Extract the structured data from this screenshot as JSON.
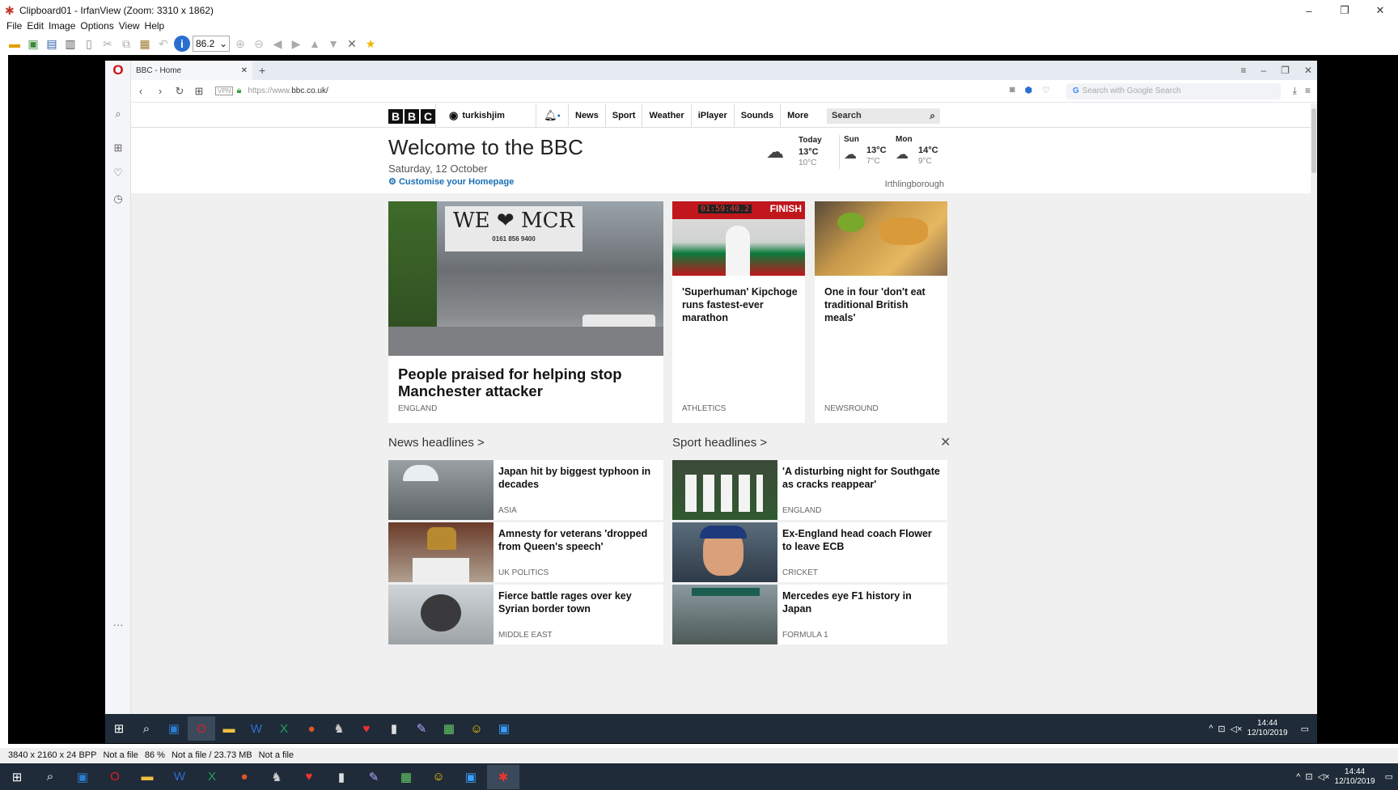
{
  "irfanview": {
    "title": "Clipboard01 - IrfanView (Zoom: 3310 x 1862)",
    "menu": [
      "File",
      "Edit",
      "Image",
      "Options",
      "View",
      "Help"
    ],
    "zoom_value": "86.2",
    "status": [
      "3840 x 2160 x 24 BPP",
      "Not a file",
      "86 %",
      "Not a file / 23.73 MB",
      "Not a file"
    ],
    "window_buttons": [
      "–",
      "❐",
      "✕"
    ]
  },
  "browser": {
    "tab_title": "BBC - Home",
    "url_prefix": "https://www.",
    "url_domain": "bbc.co.uk/",
    "search_placeholder": "Search with Google Search",
    "vpn": "VPN"
  },
  "bbc": {
    "username": "turkishjim",
    "nav": [
      "News",
      "Sport",
      "Weather",
      "iPlayer",
      "Sounds"
    ],
    "more": "More",
    "search": "Search",
    "welcome_title": "Welcome to the BBC",
    "date": "Saturday, 12 October",
    "customise": "Customise your Homepage",
    "weather": {
      "days": [
        {
          "name": "Today",
          "hi": "13°C",
          "lo": "10°C"
        },
        {
          "name": "Sun",
          "hi": "13°C",
          "lo": "7°C"
        },
        {
          "name": "Mon",
          "hi": "14°C",
          "lo": "9°C"
        }
      ],
      "location": "Irthlingborough"
    },
    "top_stories": [
      {
        "headline": "People praised for helping stop Manchester attacker",
        "tag": "ENGLAND",
        "image_text": "WE ❤ MCR",
        "image_sub": "0161 856 9400"
      },
      {
        "headline": "'Superhuman' Kipchoge runs fastest-ever marathon",
        "tag": "ATHLETICS",
        "image_text": "01:59:40.2",
        "image_sub": "FINISH"
      },
      {
        "headline": "One in four 'don't eat traditional British meals'",
        "tag": "NEWSROUND"
      }
    ],
    "news_heading": "News headlines >",
    "sport_heading": "Sport headlines >",
    "news": [
      {
        "headline": "Japan hit by biggest typhoon in decades",
        "tag": "ASIA"
      },
      {
        "headline": "Amnesty for veterans 'dropped from Queen's speech'",
        "tag": "UK POLITICS"
      },
      {
        "headline": "Fierce battle rages over key Syrian border town",
        "tag": "MIDDLE EAST"
      }
    ],
    "sport": [
      {
        "headline": "'A disturbing night for Southgate as cracks reappear'",
        "tag": "ENGLAND"
      },
      {
        "headline": "Ex-England head coach Flower to leave ECB",
        "tag": "CRICKET"
      },
      {
        "headline": "Mercedes eye F1 history in Japan",
        "tag": "FORMULA 1"
      }
    ]
  },
  "taskbar": {
    "inner_time": "14:44",
    "inner_date": "12/10/2019",
    "outer_time": "14:44",
    "outer_date": "12/10/2019"
  },
  "colors": {
    "bbc_link": "#1a6fb5",
    "taskbar": "#1f2b38",
    "opera_red": "#cc0f16"
  }
}
